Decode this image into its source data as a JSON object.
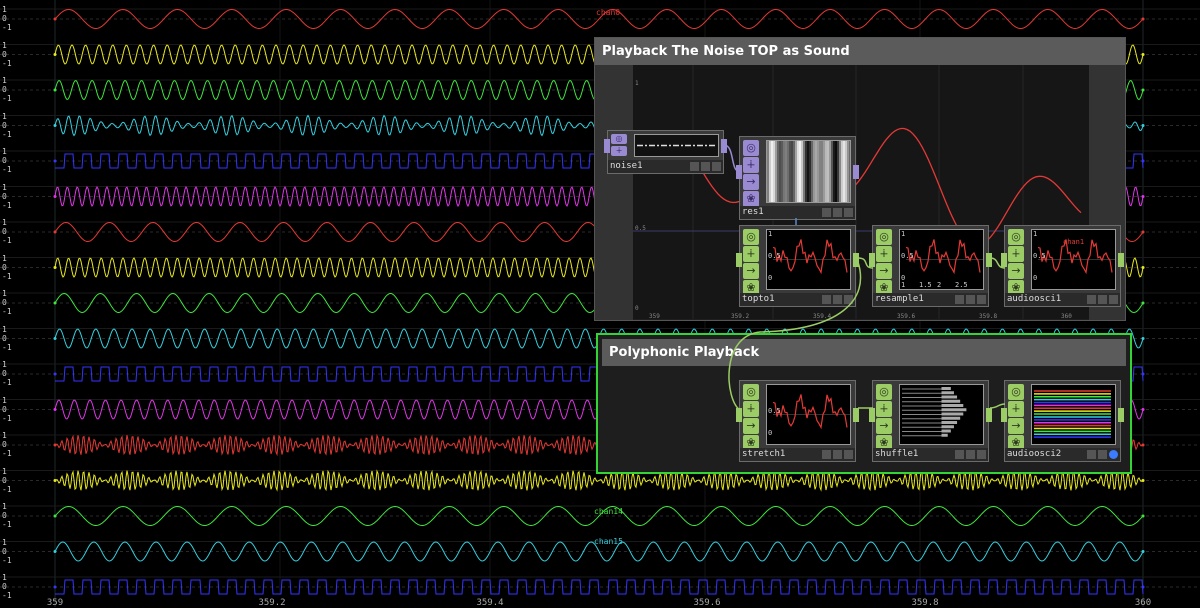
{
  "x_axis": {
    "ticks": [
      "359",
      "359.2",
      "359.4",
      "359.6",
      "359.8",
      "360"
    ]
  },
  "y_ticks": [
    "1",
    "0",
    "-1"
  ],
  "channel_labels": [
    "chan0",
    "chan14",
    "chan15"
  ],
  "channel_colors": [
    "#e53935",
    "#e8e81e",
    "#3ee63e",
    "#35d0e0",
    "#3535ff",
    "#e035e8",
    "#e53935",
    "#e8e81e",
    "#3ee63e",
    "#35d0e0",
    "#3535ff",
    "#e035e8",
    "#e53935",
    "#e8e81e",
    "#3ee63e",
    "#35d0e0",
    "#3535ff"
  ],
  "panel_top": {
    "title": "Playback The Noise TOP as Sound",
    "x_ticks": [
      "359",
      "359.2",
      "359.4",
      "359.6",
      "359.8",
      "360"
    ],
    "y_ticks": [
      "1",
      "0.5",
      "0"
    ]
  },
  "panel_bottom": {
    "title": "Polyphonic Playback"
  },
  "nodes": {
    "noise1": {
      "name": "noise1"
    },
    "res1": {
      "name": "res1"
    },
    "topto1": {
      "name": "topto1",
      "ticks": [
        "1",
        "0.5",
        "0"
      ]
    },
    "resample1": {
      "name": "resample1",
      "ticks": [
        "1",
        "0.5",
        "0"
      ],
      "xticks": [
        "1",
        "1.5",
        "2",
        "2.5"
      ]
    },
    "audioosci1": {
      "name": "audioosci1",
      "ticks": [
        "1",
        "0.5",
        "0"
      ],
      "label": "chan1"
    },
    "stretch1": {
      "name": "stretch1",
      "ticks": [
        "0.5",
        "0"
      ]
    },
    "shuffle1": {
      "name": "shuffle1"
    },
    "audioosci2": {
      "name": "audioosci2"
    }
  },
  "colors": {
    "panel_header": "#5b5b5b",
    "chop_green": "#9ccc65",
    "top_purple": "#9a8ad2",
    "selection": "#35d435"
  }
}
